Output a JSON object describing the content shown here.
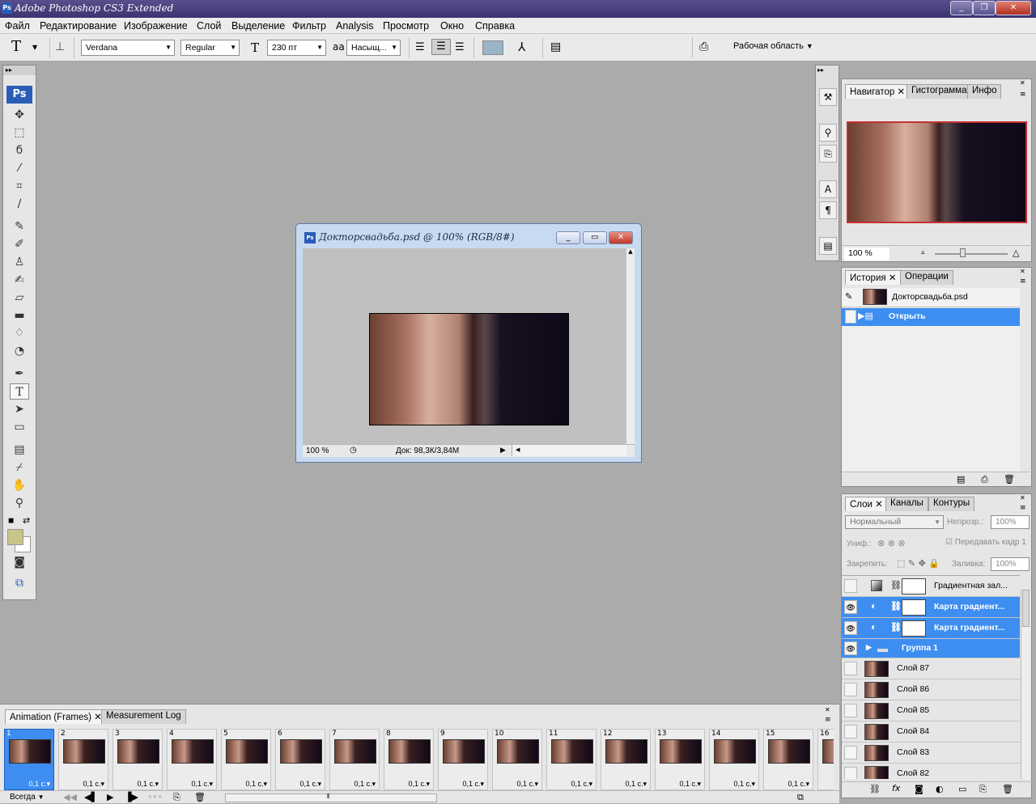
{
  "app": {
    "title": "Adobe Photoshop CS3 Extended",
    "ps_badge": "Ps"
  },
  "menu": [
    "Файл",
    "Редактирование",
    "Изображение",
    "Слой",
    "Выделение",
    "Фильтр",
    "Analysis",
    "Просмотр",
    "Окно",
    "Справка"
  ],
  "options": {
    "tool_glyph": "T",
    "font_family": "Verdana",
    "font_style": "Regular",
    "font_size": "230 пт",
    "aa_label": "аа",
    "antialias": "Насыщ...",
    "workspace": "Рабочая область"
  },
  "document": {
    "title": "Докторсвадьба.psd @ 100% (RGB/8#)",
    "zoom": "100 %",
    "doc_info": "Док: 98,3К/3,84М"
  },
  "navigator": {
    "tabs": [
      "Навигатор",
      "Гистограмма",
      "Инфо"
    ],
    "zoom": "100 %"
  },
  "history": {
    "tabs": [
      "История",
      "Операции"
    ],
    "snapshot": "Докторсвадьба.psd",
    "items": [
      "Открыть"
    ]
  },
  "layers": {
    "tabs": [
      "Слои",
      "Каналы",
      "Контуры"
    ],
    "blend_mode": "Нормальный",
    "opacity_label": "Непрозр.:",
    "opacity": "100%",
    "unify_label": "Униф.:",
    "propagate_label": "Передавать кадр 1",
    "lock_label": "Закрепить:",
    "fill_label": "Заливка:",
    "fill": "100%",
    "rows": [
      {
        "name": "Градиентная зал...",
        "visible": false,
        "selected": false,
        "kind": "adjust"
      },
      {
        "name": "Карта градиент...",
        "visible": true,
        "selected": true,
        "kind": "adjust"
      },
      {
        "name": "Карта градиент...",
        "visible": true,
        "selected": true,
        "kind": "adjust"
      },
      {
        "name": "Группа 1",
        "visible": true,
        "selected": true,
        "kind": "group"
      },
      {
        "name": "Слой 87",
        "visible": false,
        "selected": false,
        "kind": "image"
      },
      {
        "name": "Слой 86",
        "visible": false,
        "selected": false,
        "kind": "image"
      },
      {
        "name": "Слой 85",
        "visible": false,
        "selected": false,
        "kind": "image"
      },
      {
        "name": "Слой 84",
        "visible": false,
        "selected": false,
        "kind": "image"
      },
      {
        "name": "Слой 83",
        "visible": false,
        "selected": false,
        "kind": "image"
      },
      {
        "name": "Слой 82",
        "visible": false,
        "selected": false,
        "kind": "image"
      }
    ]
  },
  "animation": {
    "tabs": [
      "Animation (Frames)",
      "Measurement Log"
    ],
    "loop": "Всегда",
    "frames": [
      {
        "n": "1",
        "d": "0,1 с."
      },
      {
        "n": "2",
        "d": "0,1 с."
      },
      {
        "n": "3",
        "d": "0,1 с."
      },
      {
        "n": "4",
        "d": "0,1 с."
      },
      {
        "n": "5",
        "d": "0,1 с."
      },
      {
        "n": "6",
        "d": "0,1 с."
      },
      {
        "n": "7",
        "d": "0,1 с."
      },
      {
        "n": "8",
        "d": "0,1 с."
      },
      {
        "n": "9",
        "d": "0,1 с."
      },
      {
        "n": "10",
        "d": "0,1 с."
      },
      {
        "n": "11",
        "d": "0,1 с."
      },
      {
        "n": "12",
        "d": "0,1 с."
      },
      {
        "n": "13",
        "d": "0,1 с."
      },
      {
        "n": "14",
        "d": "0,1 с."
      },
      {
        "n": "15",
        "d": "0,1 с."
      },
      {
        "n": "16",
        "d": ""
      }
    ]
  },
  "colors": {
    "accent": "#3d8ef0",
    "foreground_swatch": "#c8c48a",
    "nav_frame": "#c83030"
  }
}
